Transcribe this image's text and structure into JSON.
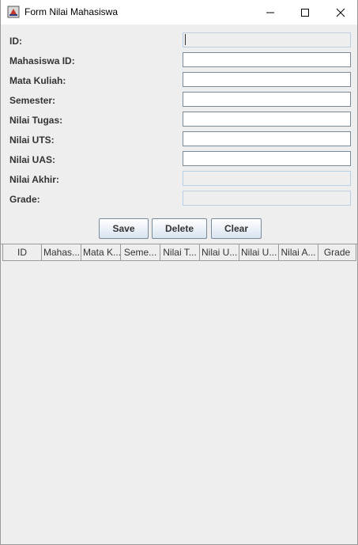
{
  "window": {
    "title": "Form Nilai Mahasiswa"
  },
  "form": {
    "fields": [
      {
        "label": "ID:",
        "value": "",
        "readonly": true
      },
      {
        "label": "Mahasiswa ID:",
        "value": "",
        "readonly": false
      },
      {
        "label": "Mata Kuliah:",
        "value": "",
        "readonly": false
      },
      {
        "label": "Semester:",
        "value": "",
        "readonly": false
      },
      {
        "label": "Nilai Tugas:",
        "value": "",
        "readonly": false
      },
      {
        "label": "Nilai UTS:",
        "value": "",
        "readonly": false
      },
      {
        "label": "Nilai UAS:",
        "value": "",
        "readonly": false
      },
      {
        "label": "Nilai Akhir:",
        "value": "",
        "readonly": true
      },
      {
        "label": "Grade:",
        "value": "",
        "readonly": true
      }
    ]
  },
  "buttons": {
    "save": "Save",
    "delete": "Delete",
    "clear": "Clear"
  },
  "table": {
    "columns": [
      "ID",
      "Mahas...",
      "Mata K...",
      "Seme...",
      "Nilai T...",
      "Nilai U...",
      "Nilai U...",
      "Nilai A...",
      "Grade"
    ],
    "rows": []
  },
  "icons": {
    "app": "java-app-icon",
    "minimize": "minimize-icon",
    "maximize": "maximize-icon",
    "close": "close-icon"
  }
}
